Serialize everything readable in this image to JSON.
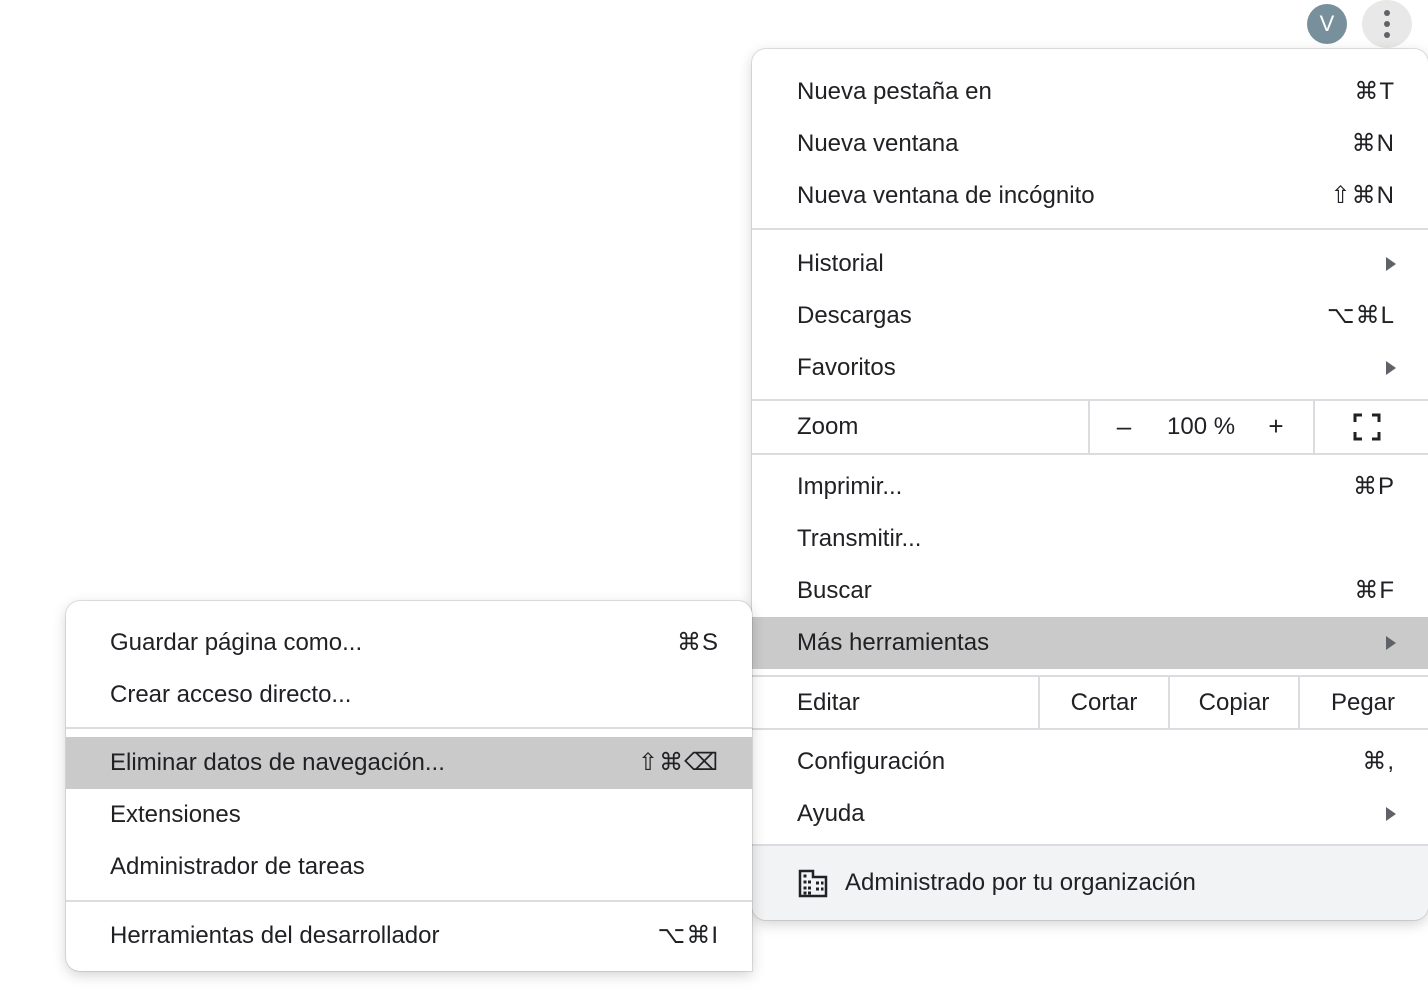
{
  "toolbar": {
    "avatar_initial": "V",
    "avatar_color": "#78909c",
    "menu_icon": "vertical-dots-icon"
  },
  "main_menu": {
    "new_tab": {
      "label": "Nueva pestaña en",
      "shortcut": "⌘T"
    },
    "new_window": {
      "label": "Nueva ventana",
      "shortcut": "⌘N"
    },
    "incognito": {
      "label": "Nueva ventana de incógnito",
      "shortcut": "⇧⌘N"
    },
    "history": {
      "label": "Historial",
      "has_submenu": true
    },
    "downloads": {
      "label": "Descargas",
      "shortcut": "⌥⌘L"
    },
    "bookmarks": {
      "label": "Favoritos",
      "has_submenu": true
    },
    "zoom": {
      "label": "Zoom",
      "minus": "–",
      "value": "100 %",
      "plus": "+",
      "fullscreen_icon": "fullscreen-icon"
    },
    "print": {
      "label": "Imprimir...",
      "shortcut": "⌘P"
    },
    "cast": {
      "label": "Transmitir..."
    },
    "find": {
      "label": "Buscar",
      "shortcut": "⌘F"
    },
    "more_tools": {
      "label": "Más herramientas",
      "has_submenu": true,
      "highlighted": true
    },
    "edit": {
      "label": "Editar",
      "cut": "Cortar",
      "copy": "Copiar",
      "paste": "Pegar"
    },
    "settings": {
      "label": "Configuración",
      "shortcut": "⌘,"
    },
    "help": {
      "label": "Ayuda",
      "has_submenu": true
    },
    "managed": {
      "label": "Administrado por tu organización",
      "icon": "building-icon"
    }
  },
  "sub_menu": {
    "save_page": {
      "label": "Guardar página como...",
      "shortcut": "⌘S"
    },
    "create_shortcut": {
      "label": "Crear acceso directo..."
    },
    "clear_data": {
      "label": "Eliminar datos de navegación...",
      "shortcut": "⇧⌘⌫",
      "highlighted": true
    },
    "extensions": {
      "label": "Extensiones"
    },
    "task_manager": {
      "label": "Administrador de tareas"
    },
    "dev_tools": {
      "label": "Herramientas del desarrollador",
      "shortcut": "⌥⌘I"
    }
  },
  "colors": {
    "highlight": "#cacaca",
    "separator": "#dadce0",
    "text": "#202124",
    "footer_bg": "#f1f3f4"
  }
}
